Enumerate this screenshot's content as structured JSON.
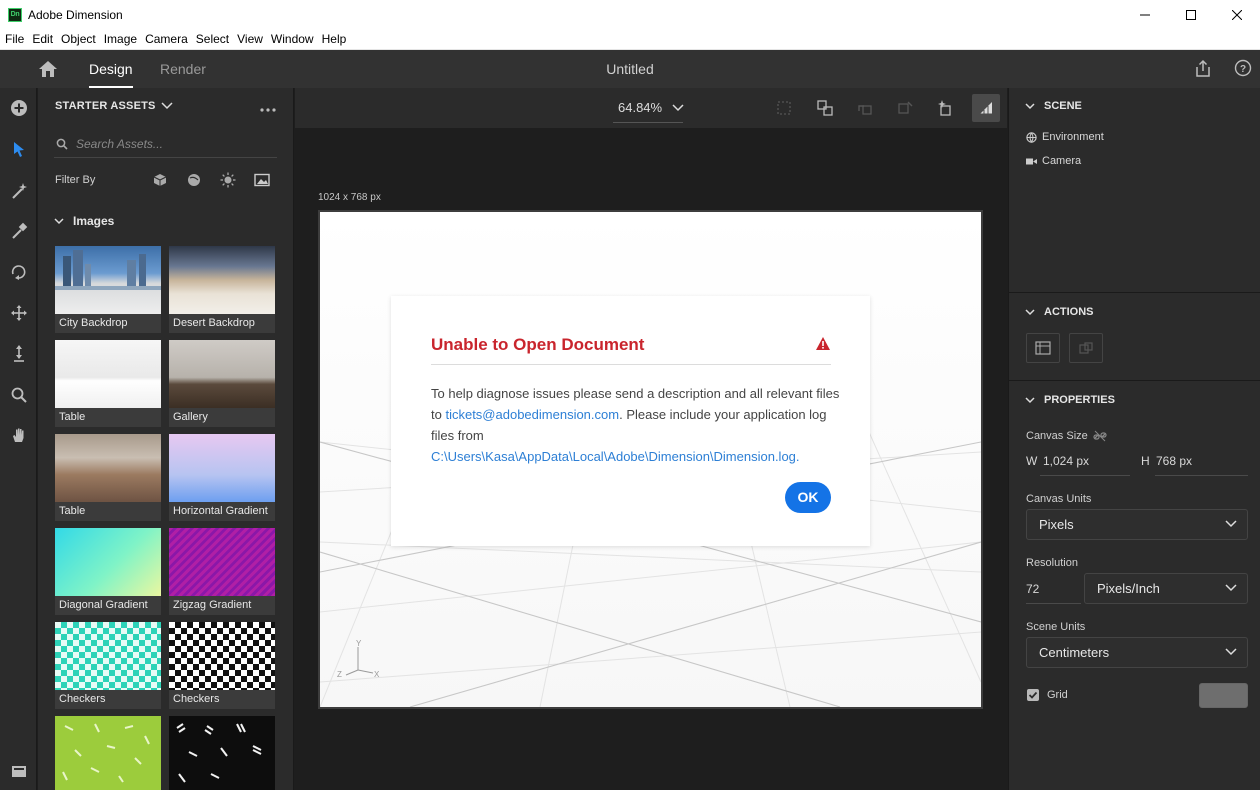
{
  "window": {
    "app_name": "Adobe Dimension",
    "logo_text": "Dn"
  },
  "menu": [
    "File",
    "Edit",
    "Object",
    "Image",
    "Camera",
    "Select",
    "View",
    "Window",
    "Help"
  ],
  "header": {
    "tab_design": "Design",
    "tab_render": "Render",
    "document_title": "Untitled"
  },
  "assets": {
    "title": "STARTER ASSETS",
    "search_placeholder": "Search Assets...",
    "filter_label": "Filter By",
    "section": "Images",
    "items": [
      {
        "label": "City Backdrop"
      },
      {
        "label": "Desert Backdrop"
      },
      {
        "label": "Table"
      },
      {
        "label": "Gallery"
      },
      {
        "label": "Table"
      },
      {
        "label": "Horizontal Gradient"
      },
      {
        "label": "Diagonal Gradient"
      },
      {
        "label": "Zigzag Gradient"
      },
      {
        "label": "Checkers"
      },
      {
        "label": "Checkers"
      },
      {
        "label": ""
      },
      {
        "label": ""
      }
    ]
  },
  "canvas": {
    "zoom": "64.84%",
    "size_label": "1024 x 768 px",
    "axis_y": "Y",
    "axis_x": "X",
    "axis_z": "Z"
  },
  "dialog": {
    "title": "Unable to Open Document",
    "body_part1": "To help diagnose issues please send a description and all relevant files to ",
    "email": "tickets@adobedimension.com",
    "body_part2": ". Please include your application log files from",
    "log_path": "C:\\Users\\Kasa\\AppData\\Local\\Adobe\\Dimension\\Dimension.log.",
    "ok_label": "OK"
  },
  "right_panel": {
    "scene_title": "SCENE",
    "scene_items": [
      "Environment",
      "Camera"
    ],
    "actions_title": "ACTIONS",
    "properties_title": "PROPERTIES",
    "canvas_size_label": "Canvas Size",
    "width_prefix": "W",
    "width_value": "1,024 px",
    "height_prefix": "H",
    "height_value": "768 px",
    "canvas_units_label": "Canvas Units",
    "canvas_units_value": "Pixels",
    "resolution_label": "Resolution",
    "resolution_value": "72",
    "resolution_unit": "Pixels/Inch",
    "scene_units_label": "Scene Units",
    "scene_units_value": "Centimeters",
    "grid_label": "Grid",
    "grid_checked": true,
    "grid_color": "#6e6e6e"
  },
  "colors": {
    "accent": "#1473e6",
    "error": "#c9252d",
    "link": "#2d7fd5"
  }
}
